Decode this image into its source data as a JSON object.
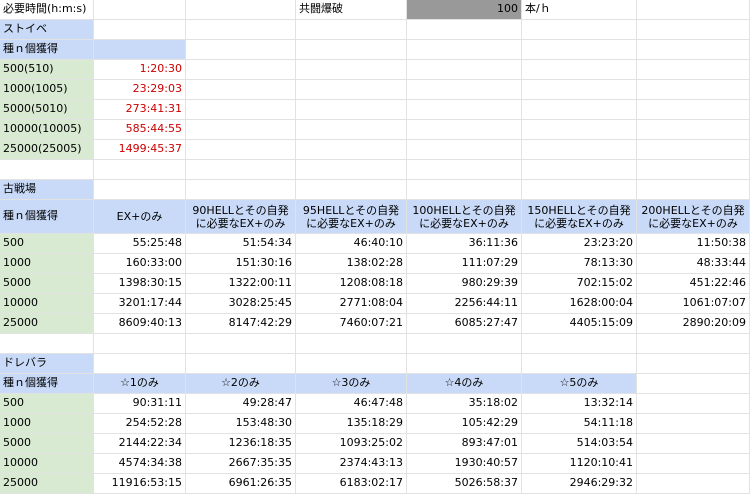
{
  "header": {
    "label": "必要時間(h:m:s)",
    "rate_label": "共闘爆破",
    "rate_value": "100",
    "rate_unit": "本/ｈ"
  },
  "colors": {
    "green_header": "#d9ead3",
    "blue_header": "#c9daf8",
    "input_gray": "#999999",
    "red_text": "#cc0000",
    "grid_line": "#e2e2e2"
  },
  "strive": {
    "title": "ストイベ",
    "col_header": "種ｎ個獲得",
    "rows": [
      {
        "label": "500(510)",
        "value": "1:20:30"
      },
      {
        "label": "1000(1005)",
        "value": "23:29:03"
      },
      {
        "label": "5000(5010)",
        "value": "273:41:31"
      },
      {
        "label": "10000(10005)",
        "value": "585:44:55"
      },
      {
        "label": "25000(25005)",
        "value": "1499:45:37"
      }
    ]
  },
  "battlefield": {
    "title": "古戦場",
    "col_header": "種ｎ個獲得",
    "columns": [
      {
        "line1": "EX+のみ",
        "line2": ""
      },
      {
        "line1": "90HELLとその自発",
        "line2": "に必要なEX+のみ"
      },
      {
        "line1": "95HELLとその自発",
        "line2": "に必要なEX+のみ"
      },
      {
        "line1": "100HELLとその自発",
        "line2": "に必要なEX+のみ"
      },
      {
        "line1": "150HELLとその自発",
        "line2": "に必要なEX+のみ"
      },
      {
        "line1": "200HELLとその自発",
        "line2": "に必要なEX+のみ"
      }
    ],
    "rows": [
      {
        "label": "500",
        "values": [
          "55:25:48",
          "51:54:34",
          "46:40:10",
          "36:11:36",
          "23:23:20",
          "11:50:38"
        ]
      },
      {
        "label": "1000",
        "values": [
          "160:33:00",
          "151:30:16",
          "138:02:28",
          "111:07:29",
          "78:13:30",
          "48:33:44"
        ]
      },
      {
        "label": "5000",
        "values": [
          "1398:30:15",
          "1322:00:11",
          "1208:08:18",
          "980:29:39",
          "702:15:02",
          "451:22:46"
        ]
      },
      {
        "label": "10000",
        "values": [
          "3201:17:44",
          "3028:25:45",
          "2771:08:04",
          "2256:44:11",
          "1628:00:04",
          "1061:07:07"
        ]
      },
      {
        "label": "25000",
        "values": [
          "8609:40:13",
          "8147:42:29",
          "7460:07:21",
          "6085:27:47",
          "4405:15:09",
          "2890:20:09"
        ]
      }
    ]
  },
  "dorebara": {
    "title": "ドレバラ",
    "col_header": "種ｎ個獲得",
    "columns": [
      "☆1のみ",
      "☆2のみ",
      "☆3のみ",
      "☆4のみ",
      "☆5のみ"
    ],
    "rows": [
      {
        "label": "500",
        "values": [
          "90:31:11",
          "49:28:47",
          "46:47:48",
          "35:18:02",
          "13:32:14"
        ]
      },
      {
        "label": "1000",
        "values": [
          "254:52:28",
          "153:48:30",
          "135:18:29",
          "105:42:29",
          "54:11:18"
        ]
      },
      {
        "label": "5000",
        "values": [
          "2144:22:34",
          "1236:18:35",
          "1093:25:02",
          "893:47:01",
          "514:03:54"
        ]
      },
      {
        "label": "10000",
        "values": [
          "4574:34:38",
          "2667:35:35",
          "2374:43:13",
          "1930:40:57",
          "1120:10:41"
        ]
      },
      {
        "label": "25000",
        "values": [
          "11916:53:15",
          "6961:26:35",
          "6183:02:17",
          "5026:58:37",
          "2946:29:32"
        ]
      }
    ]
  }
}
